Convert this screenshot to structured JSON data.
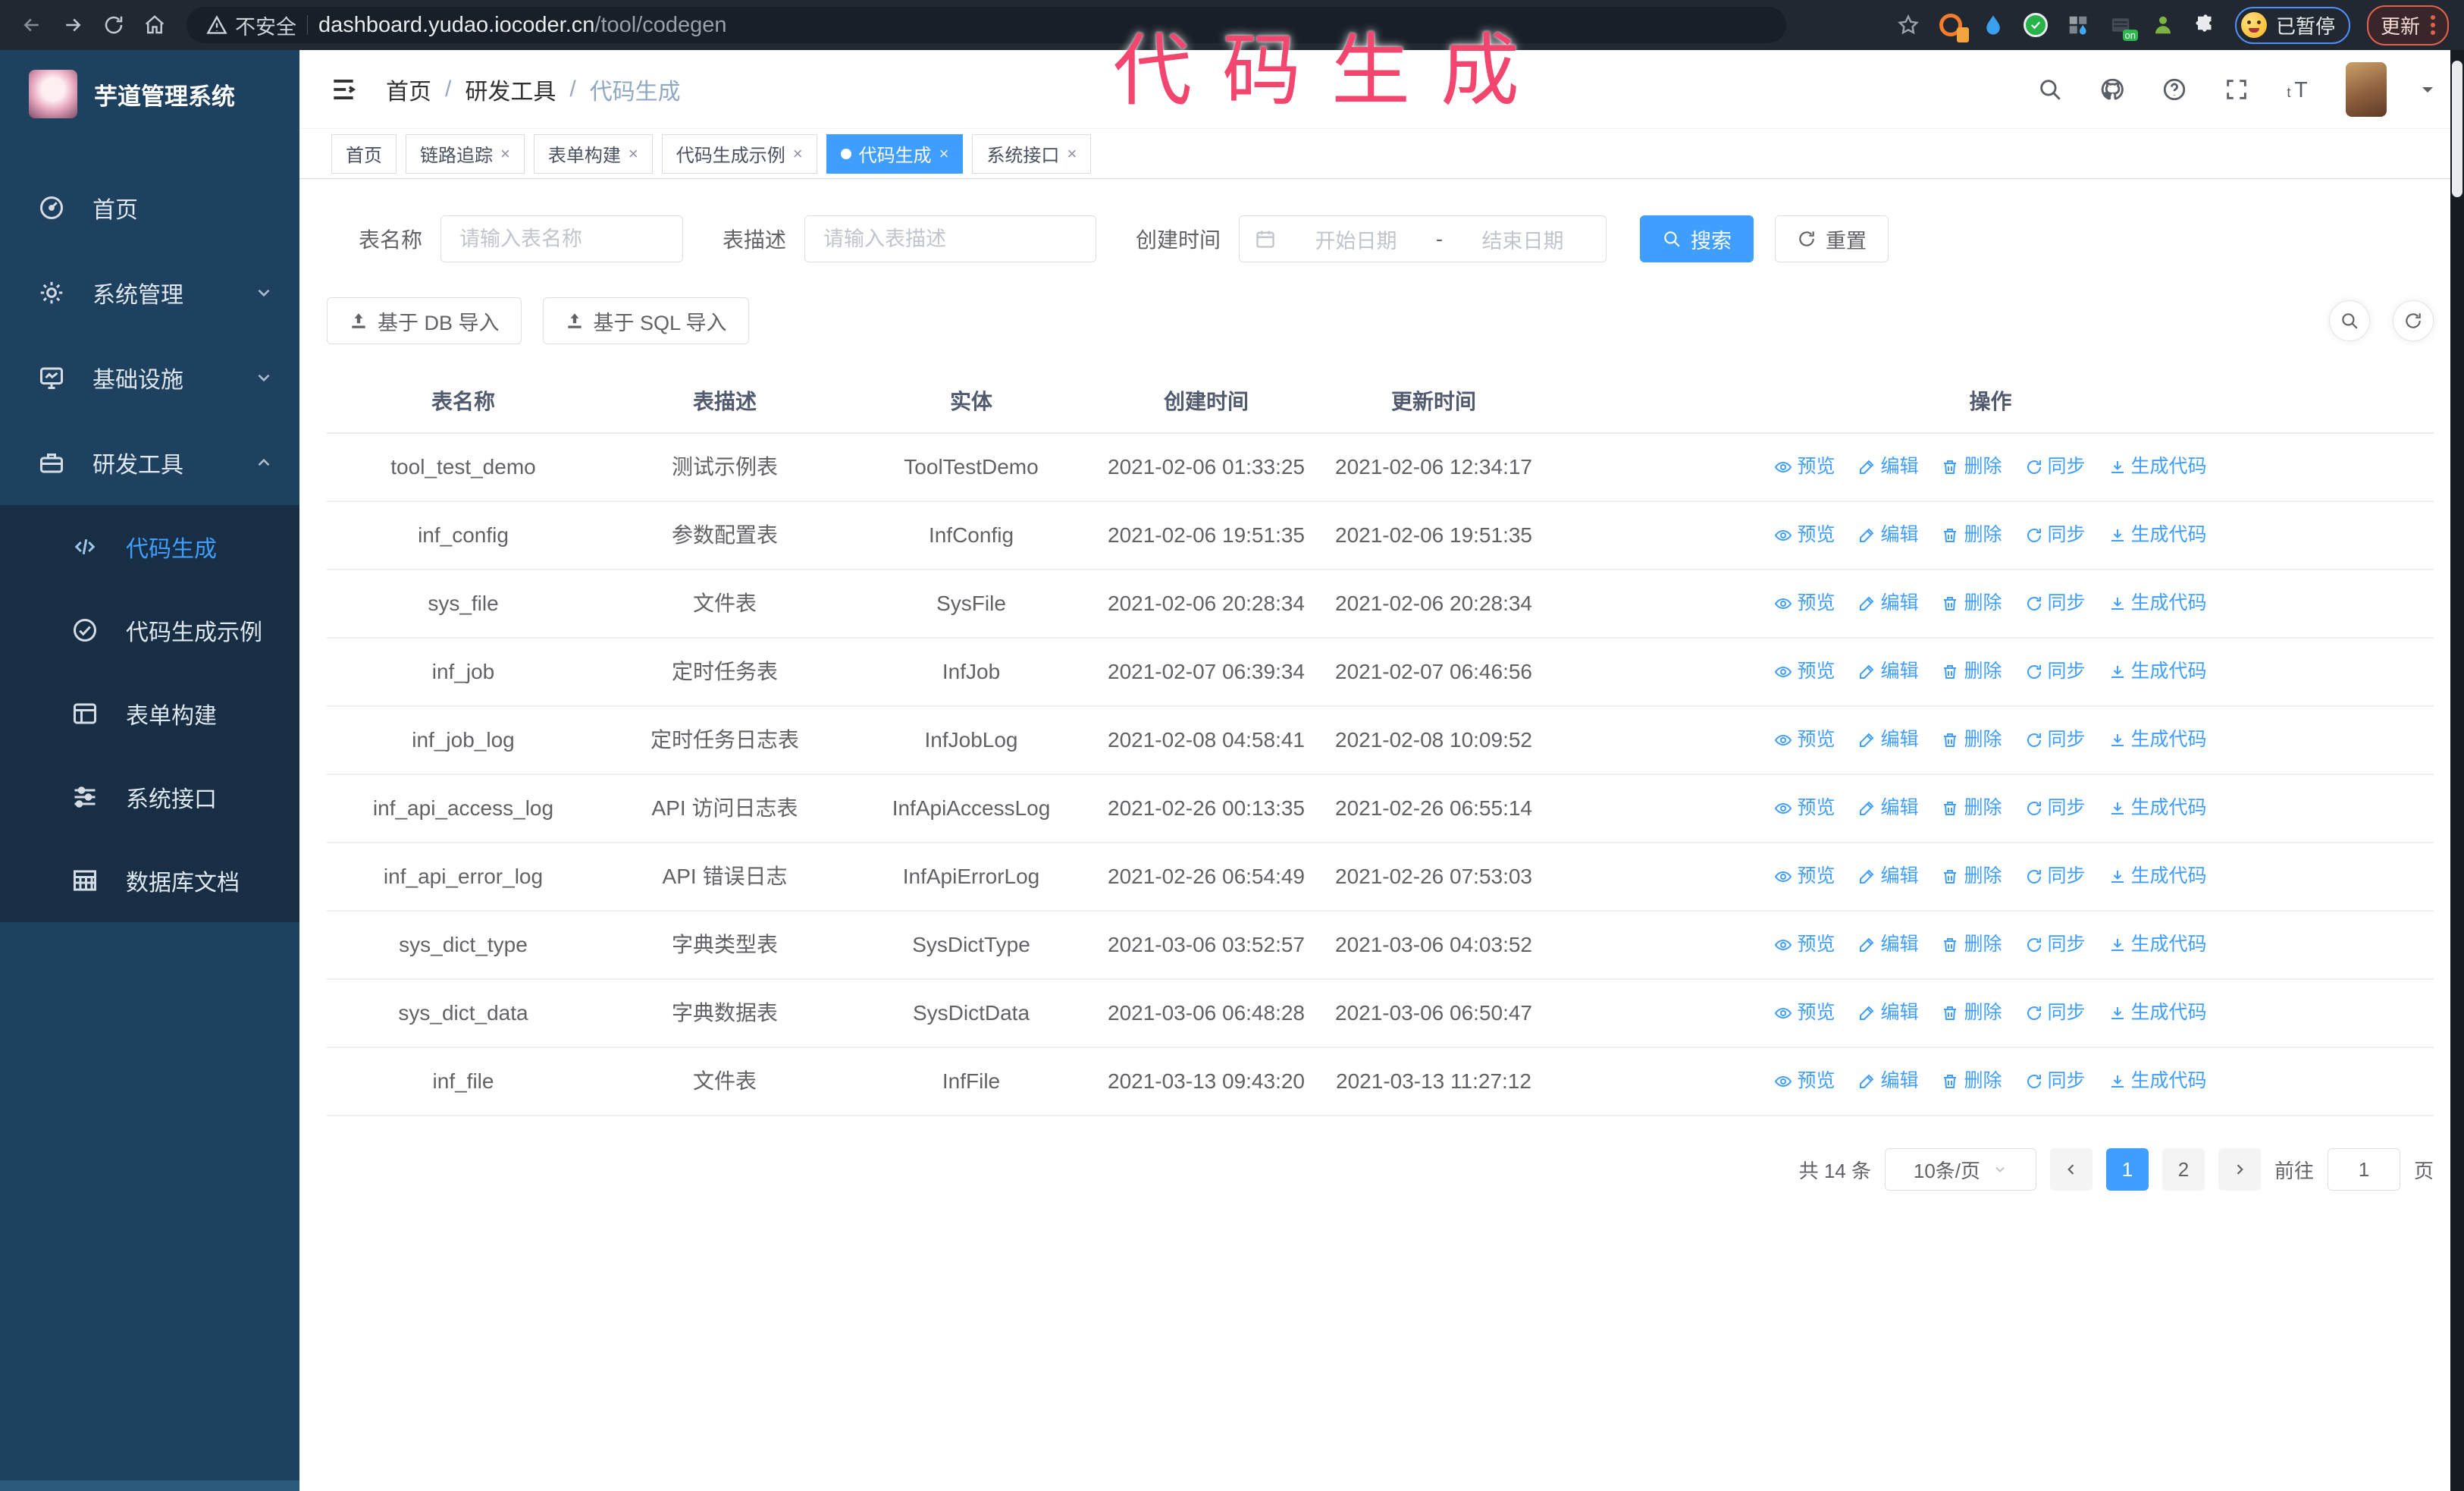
{
  "browser": {
    "security_label": "不安全",
    "url_host": "dashboard.yudao.iocoder.cn",
    "url_path": "/tool/codegen",
    "paused_badge": "已暂停",
    "update_label": "更新"
  },
  "annotation": {
    "text": "代码生成",
    "color": "#f3466e"
  },
  "sidebar": {
    "title": "芋道管理系统",
    "items": [
      {
        "label": "首页",
        "icon": "dashboard-icon",
        "expandable": false,
        "expanded": false
      },
      {
        "label": "系统管理",
        "icon": "gear-icon",
        "expandable": true,
        "expanded": false
      },
      {
        "label": "基础设施",
        "icon": "monitor-icon",
        "expandable": true,
        "expanded": false
      },
      {
        "label": "研发工具",
        "icon": "toolbox-icon",
        "expandable": true,
        "expanded": true
      }
    ],
    "submenu": [
      {
        "label": "代码生成",
        "icon": "code-icon",
        "active": true
      },
      {
        "label": "代码生成示例",
        "icon": "circle-check-icon",
        "active": false
      },
      {
        "label": "表单构建",
        "icon": "form-icon",
        "active": false
      },
      {
        "label": "系统接口",
        "icon": "sliders-icon",
        "active": false
      },
      {
        "label": "数据库文档",
        "icon": "database-icon",
        "active": false
      }
    ]
  },
  "header": {
    "breadcrumb": [
      "首页",
      "研发工具",
      "代码生成"
    ]
  },
  "tabs": [
    {
      "label": "首页",
      "closable": false,
      "active": false
    },
    {
      "label": "链路追踪",
      "closable": true,
      "active": false
    },
    {
      "label": "表单构建",
      "closable": true,
      "active": false
    },
    {
      "label": "代码生成示例",
      "closable": true,
      "active": false
    },
    {
      "label": "代码生成",
      "closable": true,
      "active": true
    },
    {
      "label": "系统接口",
      "closable": true,
      "active": false
    }
  ],
  "filters": {
    "name_label": "表名称",
    "name_placeholder": "请输入表名称",
    "desc_label": "表描述",
    "desc_placeholder": "请输入表描述",
    "time_label": "创建时间",
    "start_placeholder": "开始日期",
    "range_separator": "-",
    "end_placeholder": "结束日期",
    "search_label": "搜索",
    "reset_label": "重置"
  },
  "toolbar": {
    "import_db_label": "基于 DB 导入",
    "import_sql_label": "基于 SQL 导入"
  },
  "table": {
    "columns": [
      "表名称",
      "表描述",
      "实体",
      "创建时间",
      "更新时间",
      "操作"
    ],
    "action_labels": [
      "预览",
      "编辑",
      "删除",
      "同步",
      "生成代码"
    ],
    "action_icons": [
      "eye-icon",
      "edit-icon",
      "delete-icon",
      "sync-icon",
      "download-icon"
    ],
    "rows": [
      {
        "name": "tool_test_demo",
        "desc": "测试示例表",
        "entity": "ToolTestDemo",
        "created": "2021-02-06 01:33:25",
        "updated": "2021-02-06 12:34:17"
      },
      {
        "name": "inf_config",
        "desc": "参数配置表",
        "entity": "InfConfig",
        "created": "2021-02-06 19:51:35",
        "updated": "2021-02-06 19:51:35"
      },
      {
        "name": "sys_file",
        "desc": "文件表",
        "entity": "SysFile",
        "created": "2021-02-06 20:28:34",
        "updated": "2021-02-06 20:28:34"
      },
      {
        "name": "inf_job",
        "desc": "定时任务表",
        "entity": "InfJob",
        "created": "2021-02-07 06:39:34",
        "updated": "2021-02-07 06:46:56"
      },
      {
        "name": "inf_job_log",
        "desc": "定时任务日志表",
        "entity": "InfJobLog",
        "created": "2021-02-08 04:58:41",
        "updated": "2021-02-08 10:09:52"
      },
      {
        "name": "inf_api_access_log",
        "desc": "API 访问日志表",
        "entity": "InfApiAccessLog",
        "created": "2021-02-26 00:13:35",
        "updated": "2021-02-26 06:55:14"
      },
      {
        "name": "inf_api_error_log",
        "desc": "API 错误日志",
        "entity": "InfApiErrorLog",
        "created": "2021-02-26 06:54:49",
        "updated": "2021-02-26 07:53:03"
      },
      {
        "name": "sys_dict_type",
        "desc": "字典类型表",
        "entity": "SysDictType",
        "created": "2021-03-06 03:52:57",
        "updated": "2021-03-06 04:03:52"
      },
      {
        "name": "sys_dict_data",
        "desc": "字典数据表",
        "entity": "SysDictData",
        "created": "2021-03-06 06:48:28",
        "updated": "2021-03-06 06:50:47"
      },
      {
        "name": "inf_file",
        "desc": "文件表",
        "entity": "InfFile",
        "created": "2021-03-13 09:43:20",
        "updated": "2021-03-13 11:27:12"
      }
    ]
  },
  "pagination": {
    "total_label": "共 14 条",
    "page_size_label": "10条/页",
    "pages": [
      "1",
      "2"
    ],
    "active_page": "1",
    "goto_label": "前往",
    "goto_value": "1",
    "page_suffix": "页"
  },
  "colors": {
    "primary": "#409eff",
    "sidebar": "#1f4160",
    "submenu": "#172e44",
    "annotation": "#f3466e"
  }
}
